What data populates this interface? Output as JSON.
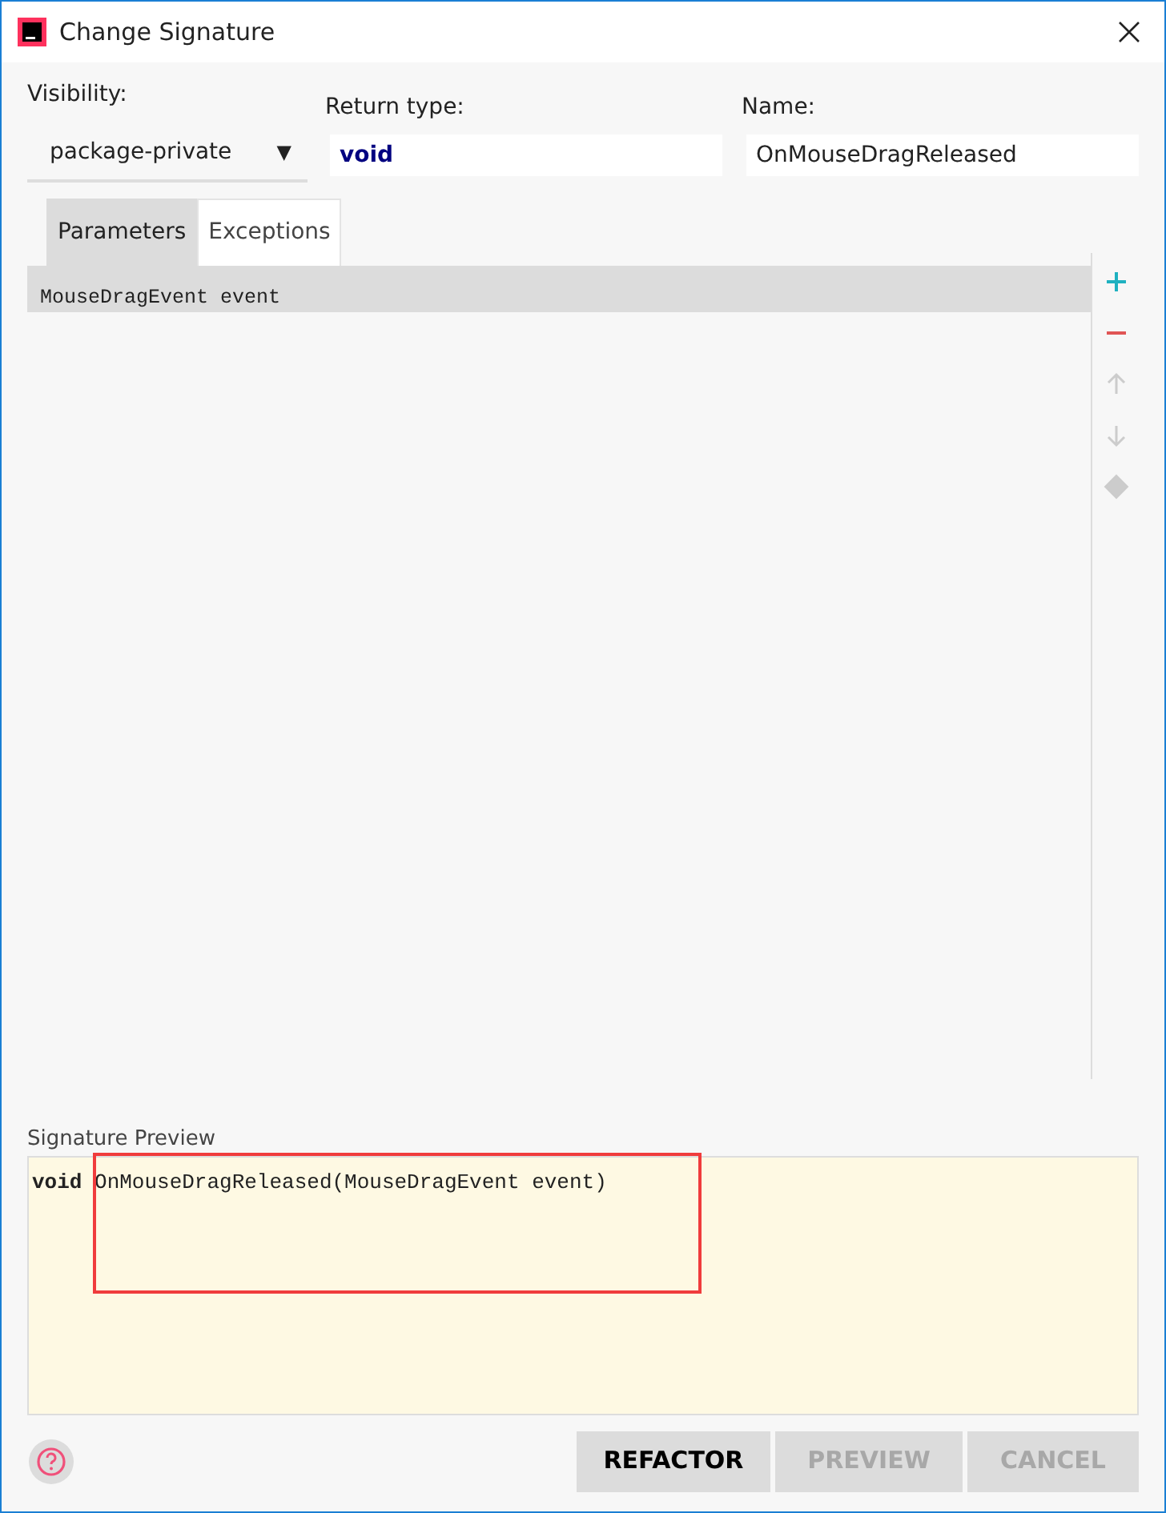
{
  "window": {
    "title": "Change Signature"
  },
  "visibility": {
    "label": "Visibility:",
    "value": "package-private",
    "arrow": "▼"
  },
  "return_type": {
    "label": "Return type:",
    "value": "void"
  },
  "name": {
    "label": "Name:",
    "value": "OnMouseDragReleased"
  },
  "tabs": [
    {
      "label": "Parameters",
      "selected": true
    },
    {
      "label": "Exceptions",
      "selected": false
    }
  ],
  "parameters": [
    {
      "text": "MouseDragEvent event",
      "selected": true
    }
  ],
  "toolbar": [
    {
      "kind": "add",
      "disabled": false
    },
    {
      "kind": "remove",
      "disabled": false
    },
    {
      "kind": "up",
      "disabled": true
    },
    {
      "kind": "down",
      "disabled": true
    },
    {
      "kind": "propagate",
      "disabled": true
    }
  ],
  "preview": {
    "label": "Signature Preview",
    "text": "**void** OnMouseDragReleased(MouseDragEvent event)"
  },
  "buttons": [
    {
      "label": "REFACTOR",
      "disabled": false
    },
    {
      "label": "PREVIEW",
      "disabled": true
    },
    {
      "label": "CANCEL",
      "disabled": true
    }
  ]
}
